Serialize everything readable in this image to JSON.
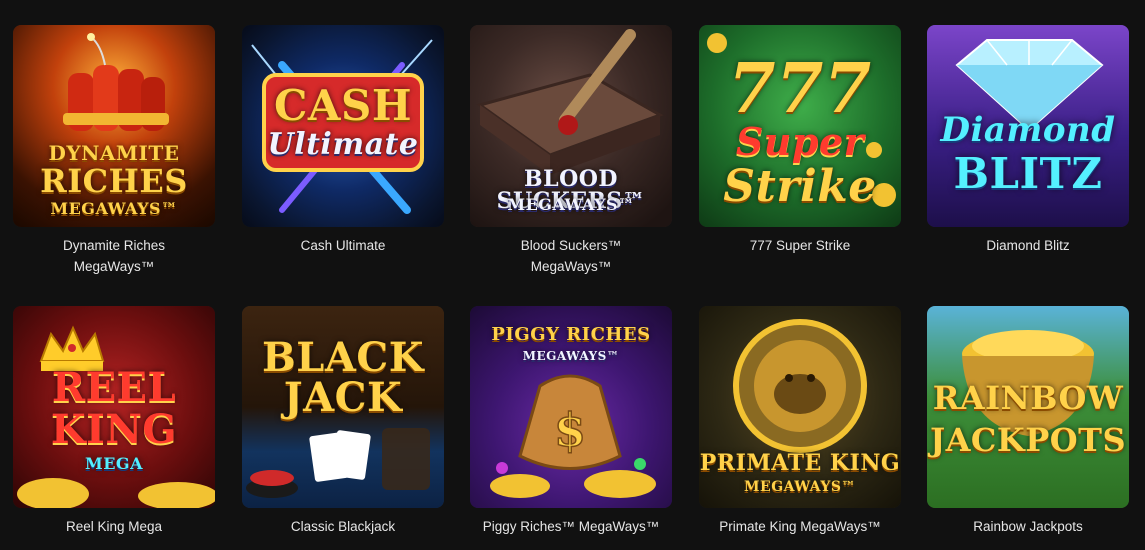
{
  "games": [
    {
      "title": "Dynamite Riches MegaWays™",
      "caption_line1": "Dynamite Riches",
      "caption_line2": "MegaWays™",
      "logo": [
        "DYNAMITE",
        "RICHES",
        "MEGAWAYS™"
      ]
    },
    {
      "title": "Cash Ultimate",
      "caption_line1": "Cash Ultimate",
      "caption_line2": "",
      "logo": [
        "CASH",
        "Ultimate"
      ]
    },
    {
      "title": "Blood Suckers™ MegaWays™",
      "caption_line1": "Blood Suckers™",
      "caption_line2": "MegaWays™",
      "logo": [
        "BLOOD SUCKERS™",
        "MEGAWAYS™"
      ]
    },
    {
      "title": "777 Super Strike",
      "caption_line1": "777 Super Strike",
      "caption_line2": "",
      "logo": [
        "777",
        "Super",
        "Strike"
      ]
    },
    {
      "title": "Diamond Blitz",
      "caption_line1": "Diamond Blitz",
      "caption_line2": "",
      "logo": [
        "Diamond",
        "BLITZ"
      ]
    },
    {
      "title": "Reel King Mega",
      "caption_line1": "Reel King Mega",
      "caption_line2": "",
      "logo": [
        "REEL",
        "KING",
        "MEGA"
      ]
    },
    {
      "title": "Classic Blackjack",
      "caption_line1": "Classic Blackjack",
      "caption_line2": "",
      "logo": [
        "BLACK",
        "JACK"
      ]
    },
    {
      "title": "Piggy Riches™ MegaWays™",
      "caption_line1": "Piggy Riches™ MegaWays™",
      "caption_line2": "",
      "logo": [
        "PIGGY RICHES",
        "MEGAWAYS™"
      ]
    },
    {
      "title": "Primate King MegaWays™",
      "caption_line1": "Primate King MegaWays™",
      "caption_line2": "",
      "logo": [
        "PRIMATE KING",
        "MEGAWAYS™"
      ]
    },
    {
      "title": "Rainbow Jackpots",
      "caption_line1": "Rainbow Jackpots",
      "caption_line2": "",
      "logo": [
        "RAINBOW",
        "JACKPOTS"
      ]
    }
  ],
  "theme": {
    "background": "#111111",
    "caption_color": "#e6e6e6"
  }
}
